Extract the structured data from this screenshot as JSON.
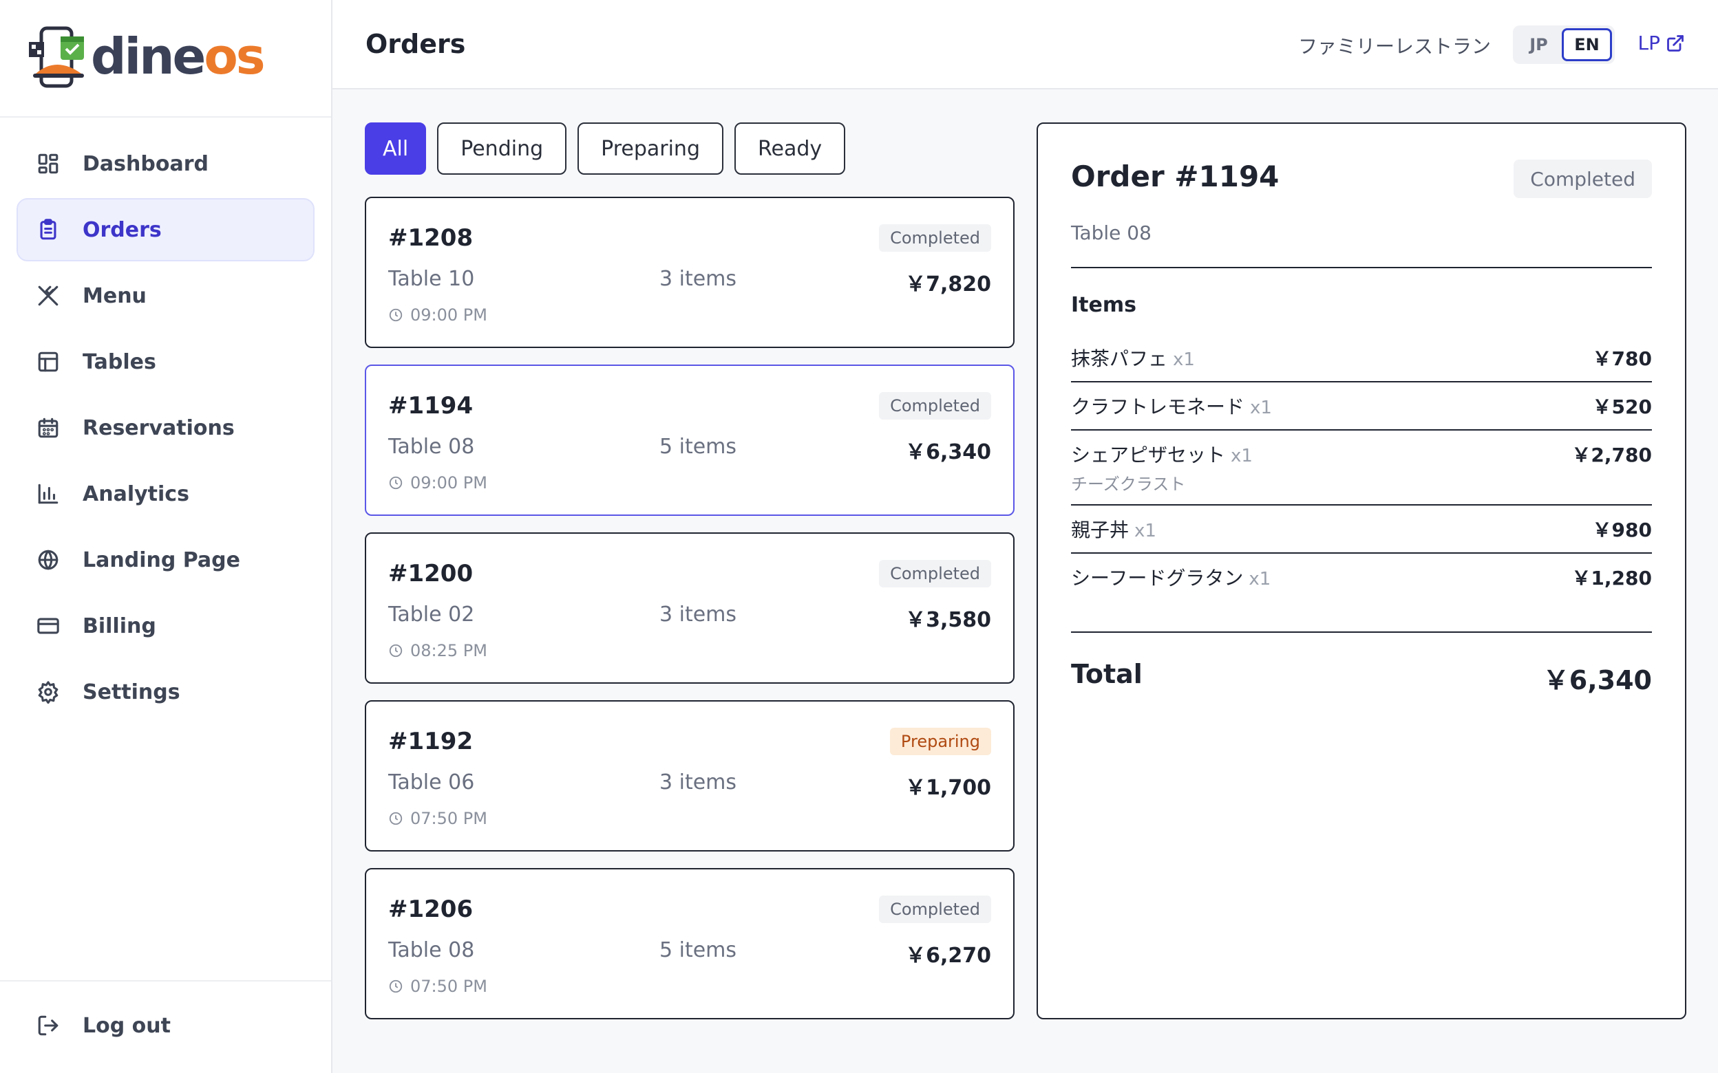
{
  "brand": {
    "name_part1": "dine",
    "name_part2": "os",
    "icon": "phone-qr-calendar-logo"
  },
  "sidebar": {
    "items": [
      {
        "label": "Dashboard",
        "icon": "dashboard-grid-icon"
      },
      {
        "label": "Orders",
        "icon": "clipboard-icon",
        "active": true
      },
      {
        "label": "Menu",
        "icon": "utensils-icon"
      },
      {
        "label": "Tables",
        "icon": "table-layout-icon"
      },
      {
        "label": "Reservations",
        "icon": "calendar-icon"
      },
      {
        "label": "Analytics",
        "icon": "bar-chart-icon"
      },
      {
        "label": "Landing Page",
        "icon": "globe-icon"
      },
      {
        "label": "Billing",
        "icon": "credit-card-icon"
      },
      {
        "label": "Settings",
        "icon": "gear-icon"
      }
    ],
    "logout_label": "Log out"
  },
  "header": {
    "title": "Orders",
    "restaurant": "ファミリーレストラン",
    "lang_jp": "JP",
    "lang_en": "EN",
    "lang_active": "EN",
    "lp_label": "LP"
  },
  "filters": [
    "All",
    "Pending",
    "Preparing",
    "Ready"
  ],
  "active_filter": "All",
  "orders": [
    {
      "number": "#1208",
      "status": "Completed",
      "table": "Table 10",
      "items": "3 items",
      "price": "￥7,820",
      "time": "09:00 PM"
    },
    {
      "number": "#1194",
      "status": "Completed",
      "table": "Table 08",
      "items": "5 items",
      "price": "￥6,340",
      "time": "09:00 PM",
      "selected": true
    },
    {
      "number": "#1200",
      "status": "Completed",
      "table": "Table 02",
      "items": "3 items",
      "price": "￥3,580",
      "time": "08:25 PM"
    },
    {
      "number": "#1192",
      "status": "Preparing",
      "table": "Table 06",
      "items": "3 items",
      "price": "￥1,700",
      "time": "07:50 PM"
    },
    {
      "number": "#1206",
      "status": "Completed",
      "table": "Table 08",
      "items": "5 items",
      "price": "￥6,270",
      "time": "07:50 PM"
    }
  ],
  "detail": {
    "title": "Order #1194",
    "status": "Completed",
    "table": "Table 08",
    "items_title": "Items",
    "items": [
      {
        "name": "抹茶パフェ",
        "qty": "x1",
        "price": "￥780"
      },
      {
        "name": "クラフトレモネード",
        "qty": "x1",
        "price": "￥520"
      },
      {
        "name": "シェアピザセット",
        "qty": "x1",
        "sub": "チーズクラスト",
        "price": "￥2,780"
      },
      {
        "name": "親子丼",
        "qty": "x1",
        "price": "￥980"
      },
      {
        "name": "シーフードグラタン",
        "qty": "x1",
        "price": "￥1,280"
      }
    ],
    "total_label": "Total",
    "total_value": "￥6,340"
  },
  "colors": {
    "accent": "#4a3ee6",
    "brand_dark": "#3b4157",
    "brand_orange": "#ec7a2b",
    "preparing_bg": "#fdebd7",
    "preparing_text": "#b04a12"
  }
}
